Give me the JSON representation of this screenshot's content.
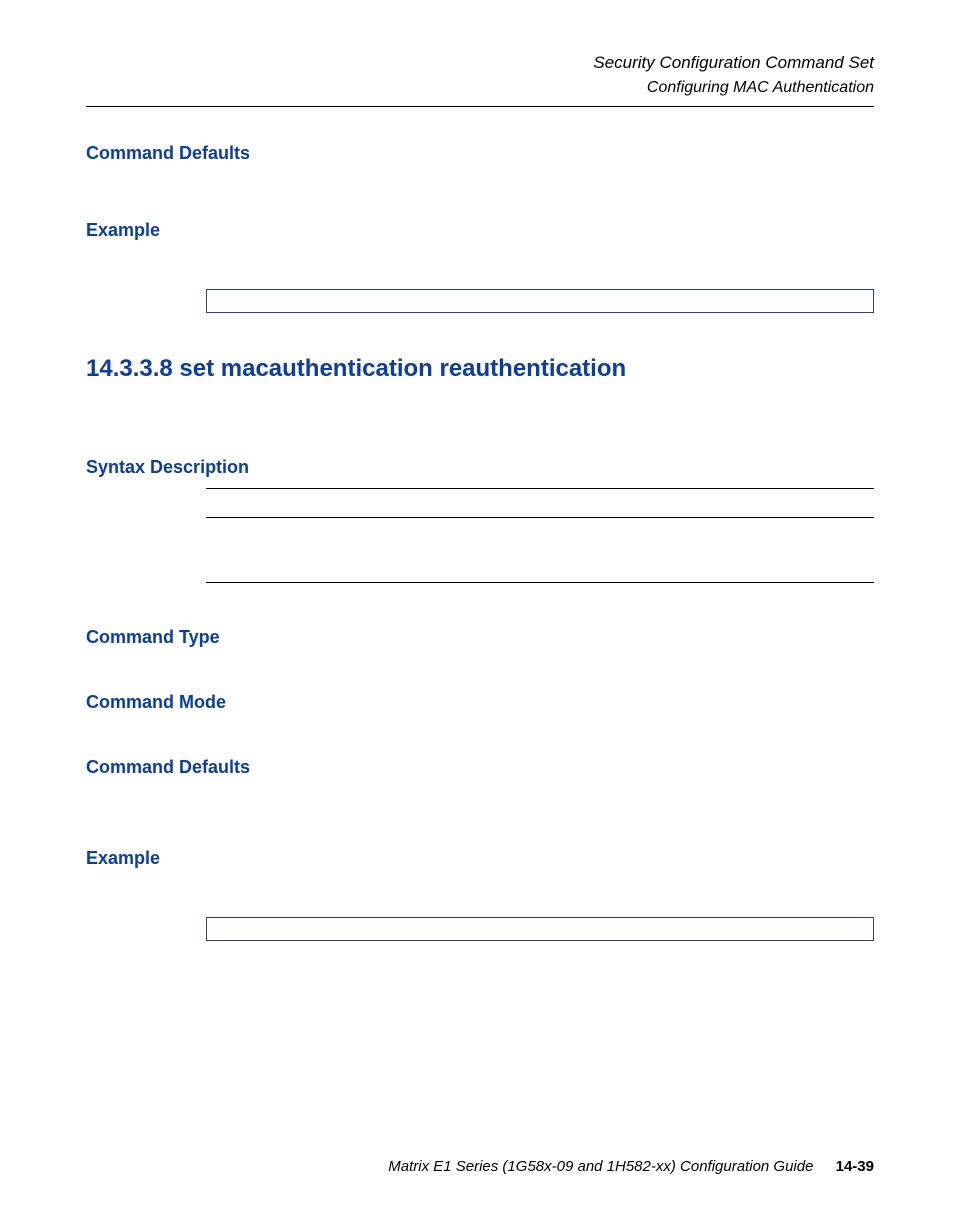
{
  "header": {
    "line1": "Security Configuration Command Set",
    "line2": "Configuring MAC Authentication"
  },
  "sections": {
    "command_defaults_1": "Command Defaults",
    "example_1": "Example",
    "main_heading": "14.3.3.8  set macauthentication reauthentication",
    "syntax_description": "Syntax Description",
    "command_type": "Command Type",
    "command_mode": "Command Mode",
    "command_defaults_2": "Command Defaults",
    "example_2": "Example"
  },
  "footer": {
    "guide": "Matrix E1 Series (1G58x-09 and 1H582-xx) Configuration Guide",
    "page": "14-39"
  }
}
